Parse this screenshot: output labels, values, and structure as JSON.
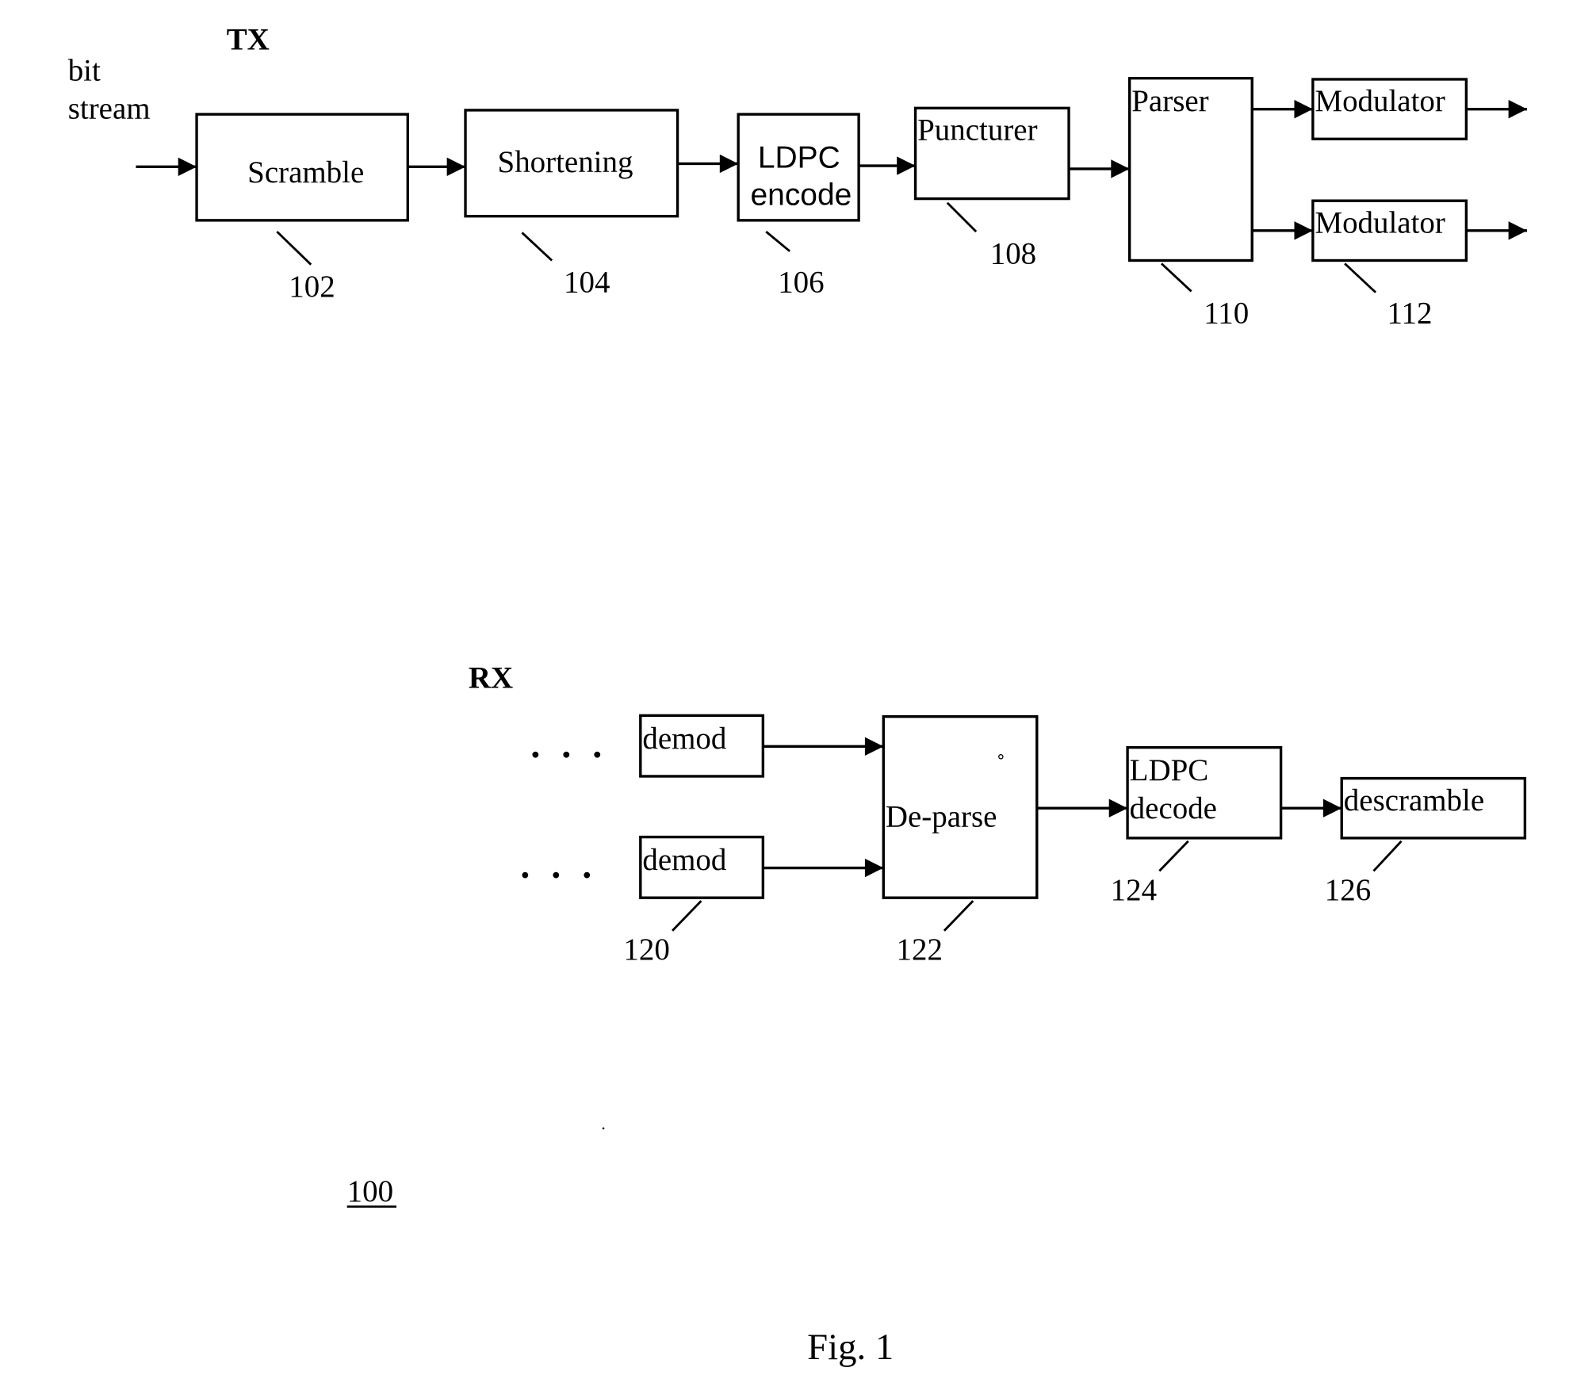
{
  "figure": {
    "caption": "Fig. 1",
    "system_ref": "100",
    "colors": {
      "ink": "#000000",
      "paper": "#ffffff"
    }
  },
  "tx": {
    "title": "TX",
    "input_label_line1": "bit",
    "input_label_line2": "stream",
    "blocks": [
      {
        "id": "scramble",
        "label": "Scramble",
        "ref": "102"
      },
      {
        "id": "shortening",
        "label": "Shortening",
        "ref": "104"
      },
      {
        "id": "ldpc-encode",
        "label_line1": "LDPC",
        "label_line2": "encode",
        "ref": "106"
      },
      {
        "id": "puncturer",
        "label": "Puncturer",
        "ref": "108"
      },
      {
        "id": "parser",
        "label": "Parser",
        "ref": "110"
      },
      {
        "id": "modulator-1",
        "label": "Modulator"
      },
      {
        "id": "modulator-2",
        "label": "Modulator",
        "ref": "112"
      }
    ]
  },
  "rx": {
    "title": "RX",
    "ellipsis": "· · ·",
    "blocks": [
      {
        "id": "demod-1",
        "label": "demod"
      },
      {
        "id": "demod-2",
        "label": "demod",
        "ref": "120"
      },
      {
        "id": "de-parse",
        "label": "De-parse",
        "ref": "122"
      },
      {
        "id": "ldpc-decode",
        "label_line1": "LDPC",
        "label_line2": "decode",
        "ref": "124"
      },
      {
        "id": "descramble",
        "label": "descramble",
        "ref": "126"
      }
    ]
  }
}
